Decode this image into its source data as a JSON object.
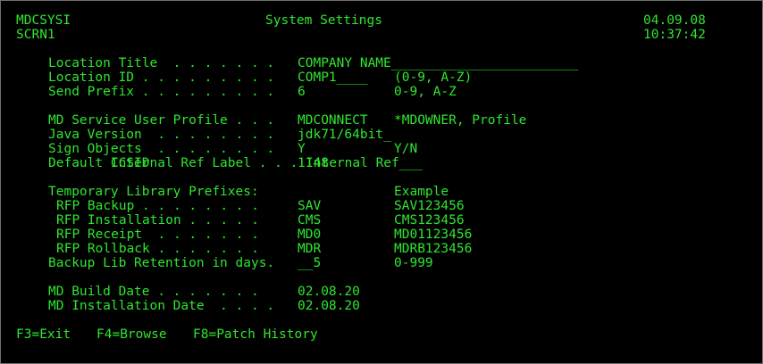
{
  "header": {
    "program": "MDCSYSI",
    "screen": "SCRN1",
    "title": "System Settings",
    "date": "04.09.08",
    "time": "10:37:42"
  },
  "fields": {
    "location_title": {
      "label": "Location Title  . . . . . . .",
      "value": "COMPANY NAME",
      "fill": "________________________"
    },
    "location_id": {
      "label": "Location ID . . . . . . . . .",
      "value": "COMP1",
      "fill": "____",
      "hint": "(0-9, A-Z)"
    },
    "send_prefix": {
      "label": "Send Prefix . . . . . . . . .",
      "value": "6",
      "hint": "0-9, A-Z"
    },
    "md_service_user": {
      "label": "MD Service User Profile . . .",
      "value": "MDCONNECT",
      "hint": "*MDOWNER, Profile"
    },
    "java_version": {
      "label": "Java Version  . . . . . . . .",
      "value": "jdk71/64bit",
      "fill": "_"
    },
    "sign_objects": {
      "label": "Sign Objects  . . . . . . . .",
      "value": "Y",
      "hint": "Y/N"
    },
    "default_ccsid": {
      "label": "Default CCSID",
      "value": "1148"
    },
    "internal_ref": {
      "label": "Internal Ref Label . . .",
      "value": "Internal Ref",
      "fill": "___"
    }
  },
  "temp_lib": {
    "heading": "Temporary Library Prefixes:",
    "example_heading": "Example",
    "rows": [
      {
        "label": "RFP Backup . . . . . . . .",
        "value": "SAV",
        "example": "SAV123456"
      },
      {
        "label": "RFP Installation . . . . .",
        "value": "CMS",
        "example": "CMS123456"
      },
      {
        "label": "RFP Receipt  . . . . . . .",
        "value": "MD0",
        "example": "MD01123456"
      },
      {
        "label": "RFP Rollback . . . . . . .",
        "value": "MDR",
        "example": "MDRB123456"
      }
    ]
  },
  "retention": {
    "label": "Backup Lib Retention in days.",
    "value": "__5",
    "hint": "0-999"
  },
  "build": {
    "build_label": "MD Build Date . . . . . . .",
    "build_value": "02.08.20",
    "install_label": "MD Installation Date  . . . .",
    "install_value": "02.08.20"
  },
  "fkeys": [
    "F3=Exit",
    "F4=Browse",
    "F8=Patch History"
  ],
  "colors": {
    "text": "#2fe62f",
    "background": "#000000",
    "border": "#6f6f6f"
  }
}
